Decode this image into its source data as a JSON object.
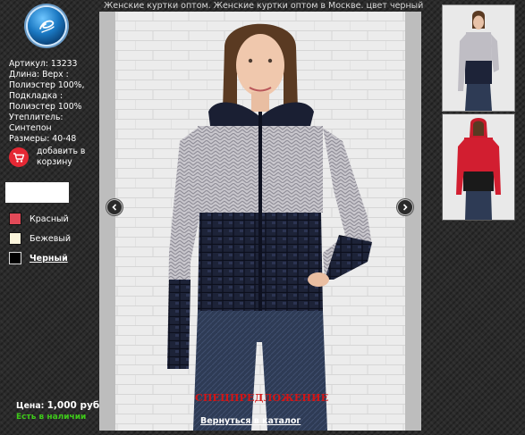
{
  "header": {
    "title": "Женские куртки оптом. Женские куртки оптом в Москве. цвет черный"
  },
  "logo": {
    "icon": "brand-logo-icon"
  },
  "product": {
    "specs": [
      "Артикул: 13233",
      "Длина: Верх :",
      "Полиэстер 100%,",
      "Подкладка :",
      "Полиэстер 100%",
      "Утеплитель:",
      "Синтепон",
      "Размеры: 40-48"
    ],
    "cart_label": "добавить в корзину",
    "price_label": "Цена:",
    "price_value": "1,000 руб.",
    "stock": "Есть в наличии",
    "special_offer": "СПЕЦПРЕДЛОЖЕНИЕ",
    "back_link": "Вернуться в каталог"
  },
  "colors": [
    {
      "label": "Красный",
      "hex": "#e24a58",
      "active": false
    },
    {
      "label": "Бежевый",
      "hex": "#fbf5dc",
      "active": false
    },
    {
      "label": "Черный",
      "hex": "#000000",
      "active": true
    }
  ],
  "palette": {
    "stock_green": "#3ec91a",
    "special_red": "#d51414",
    "cart_red": "#e52834"
  },
  "icons": {
    "cart": "cart-icon",
    "prev": "chevron-left-icon",
    "next": "chevron-right-icon"
  }
}
